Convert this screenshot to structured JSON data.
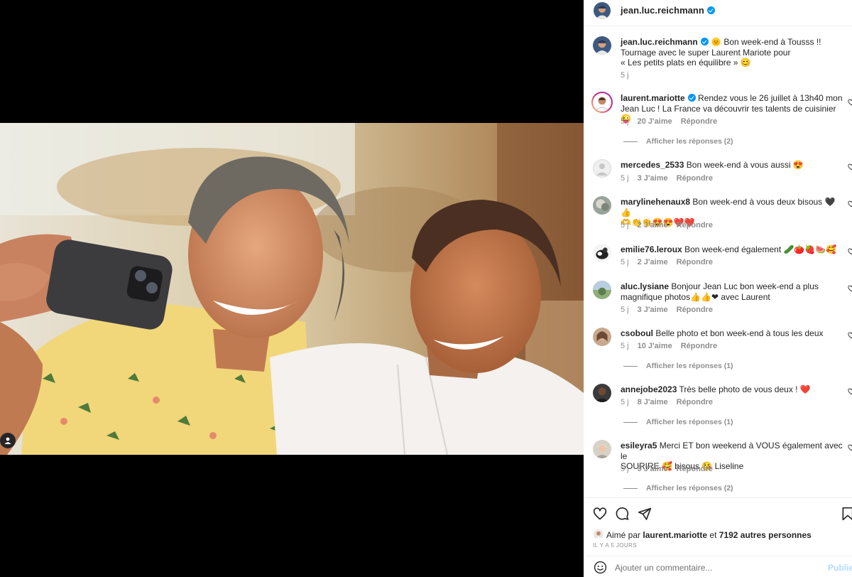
{
  "post": {
    "author": "jean.luc.reichmann",
    "caption_line1": "🌞 Bon week-end à Tousss !!",
    "caption_line2": "Tournage avec le super Laurent Mariote pour",
    "caption_line3": "« Les petits plats en équilibre » 😊",
    "caption_time": "5 j"
  },
  "comments": [
    {
      "user": "laurent.mariotte",
      "verified": true,
      "line1": "Rendez vous le 26 juillet à 13h40 mon",
      "line2": "Jean Luc ! La France va découvrir tes talents de cuisinier😜",
      "time": "5 j",
      "likes": "20 J'aime",
      "reply": "Répondre",
      "replies": "Afficher les réponses (2)"
    },
    {
      "user": "mercedes_2533",
      "line1": "Bon week-end à vous aussi 😍",
      "line2": "",
      "time": "5 j",
      "likes": "3 J'aime",
      "reply": "Répondre"
    },
    {
      "user": "marylinehenaux8",
      "line1": "Bon week-end à vous deux bisous 🖤 👍",
      "line2": "🫶👏👏😍😍❤️❤️",
      "time": "5 j",
      "likes": "2 J'aime",
      "reply": "Répondre"
    },
    {
      "user": "emilie76.leroux",
      "line1": "Bon week-end également 🥒🍅🍓🍉🥰",
      "line2": "",
      "time": "5 j",
      "likes": "2 J'aime",
      "reply": "Répondre"
    },
    {
      "user": "aluc.lysiane",
      "line1": "Bonjour Jean Luc bon week-end a plus",
      "line2": "magnifique photos👍👍❤ avec Laurent",
      "time": "5 j",
      "likes": "3 J'aime",
      "reply": "Répondre"
    },
    {
      "user": "csoboul",
      "line1": "Belle photo et bon week-end à tous les deux",
      "line2": "",
      "time": "5 j",
      "likes": "10 J'aime",
      "reply": "Répondre",
      "replies": "Afficher les réponses (1)"
    },
    {
      "user": "annejobe2023",
      "line1": "Très belle photo de vous deux ! ❤️",
      "line2": "",
      "time": "5 j",
      "likes": "8 J'aime",
      "reply": "Répondre",
      "replies": "Afficher les réponses (1)"
    },
    {
      "user": "esileyra5",
      "line1": "Merci ET bon weekend à VOUS également avec le",
      "line2": "SOURIRE 🥰 bisous 😘 Liseline",
      "time": "5 j",
      "likes": "9 J'aime",
      "reply": "Répondre",
      "replies": "Afficher les réponses (2)"
    }
  ],
  "footer": {
    "liked_prefix": "Aimé par",
    "liked_user": "laurent.mariotte",
    "liked_and": "et",
    "liked_others": "7192 autres personnes",
    "time_ago": "IL Y A 5 JOURS",
    "comment_placeholder": "Ajouter un commentaire...",
    "publish_label": "Publier"
  },
  "icons": {
    "heart": "heart-icon",
    "comment": "comment-icon",
    "share": "share-icon",
    "save": "bookmark-icon",
    "emoji": "emoji-icon",
    "tag": "user-tag-icon"
  },
  "colors": {
    "verified": "#0095f6",
    "muted": "#8e8e8e",
    "publish": "#b3dbff"
  }
}
